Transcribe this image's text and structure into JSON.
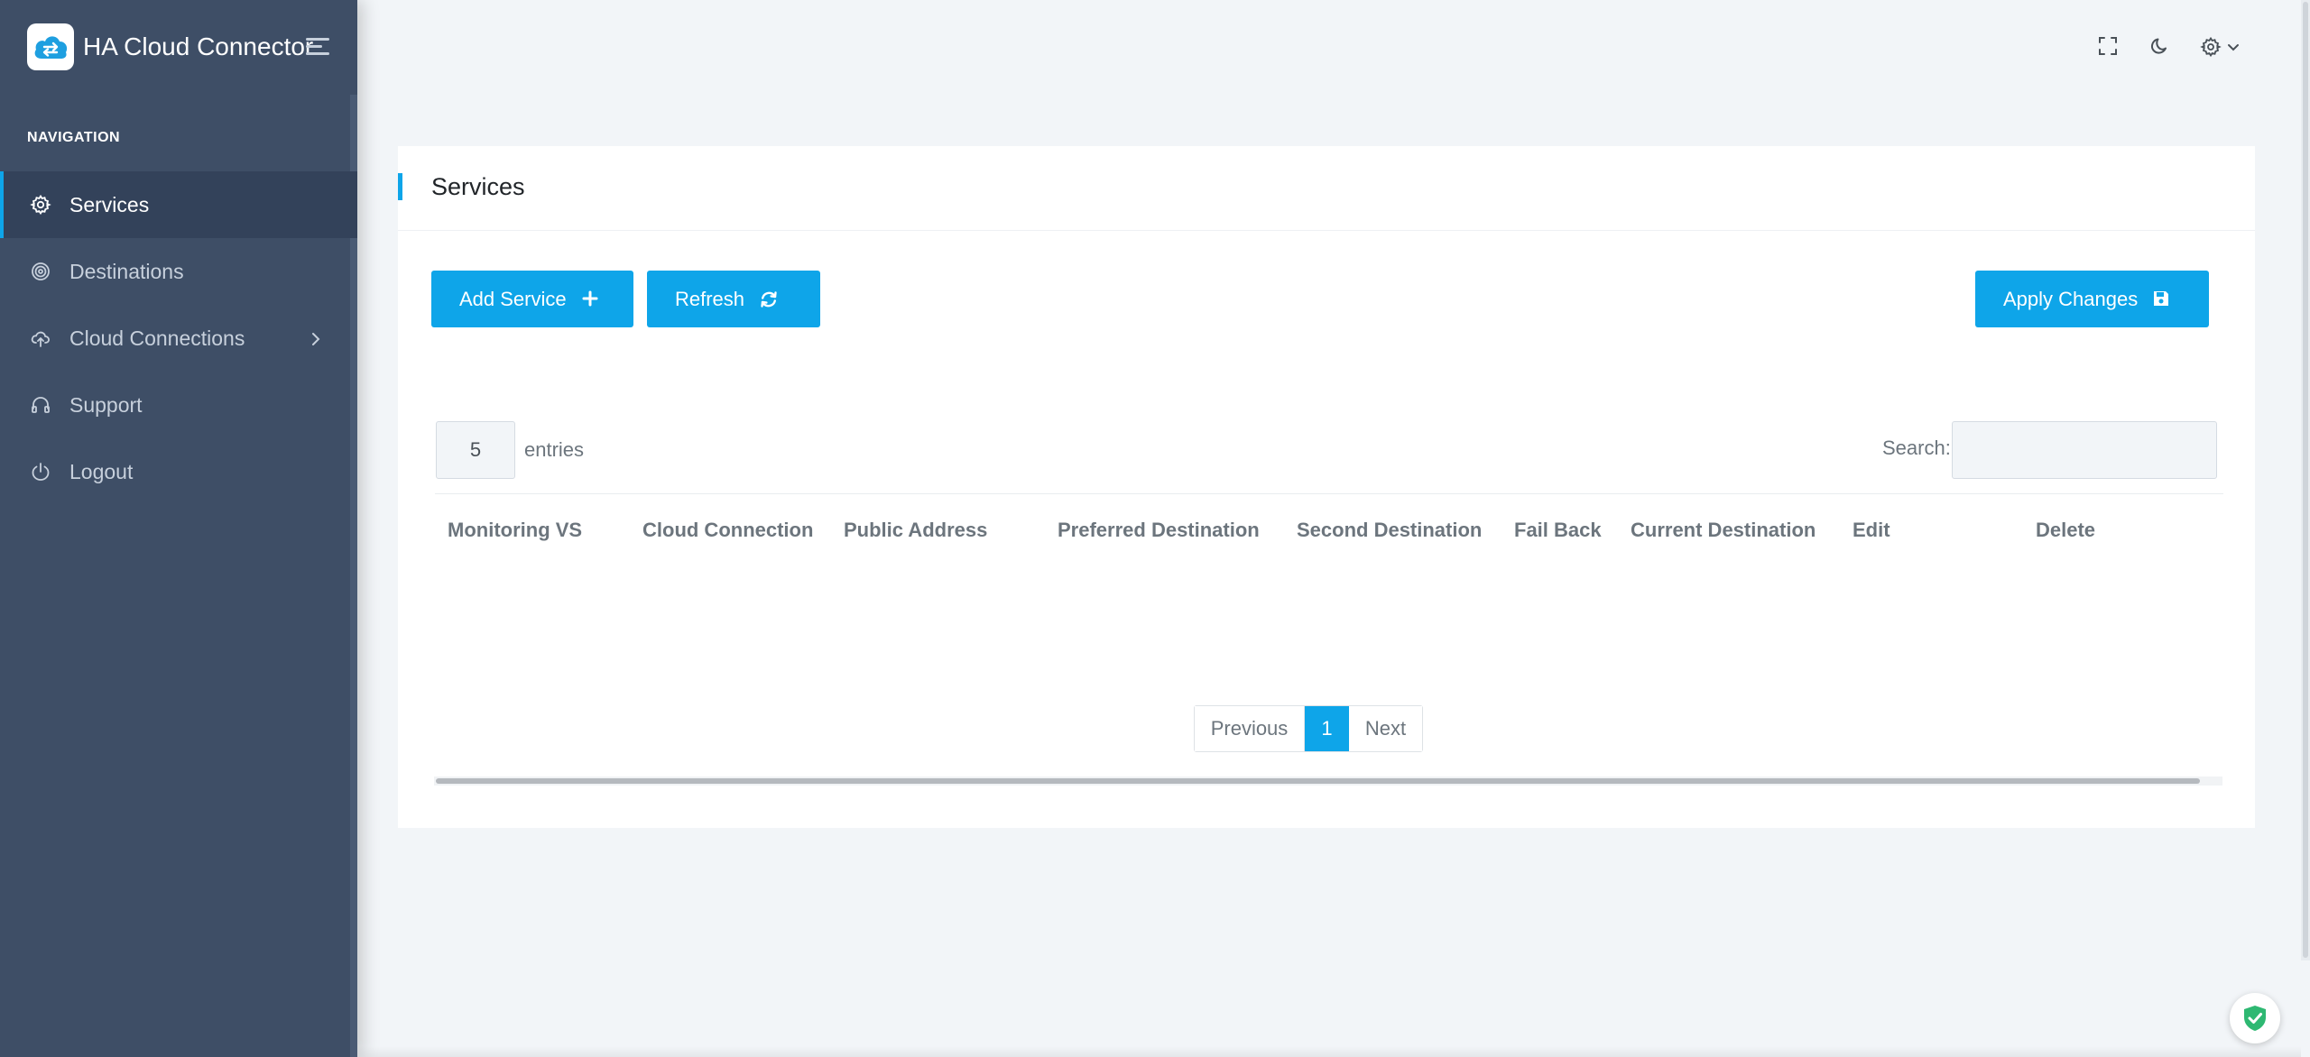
{
  "brand": {
    "title": "HA Cloud Connector"
  },
  "nav": {
    "heading": "NAVIGATION",
    "items": [
      {
        "label": "Services",
        "icon": "gear-icon",
        "active": true
      },
      {
        "label": "Destinations",
        "icon": "target-icon"
      },
      {
        "label": "Cloud Connections",
        "icon": "cloud-upload-icon",
        "has_submenu": true
      },
      {
        "label": "Support",
        "icon": "headphones-icon"
      },
      {
        "label": "Logout",
        "icon": "power-icon"
      }
    ]
  },
  "topbar": {
    "icons": [
      "fullscreen-icon",
      "moon-icon",
      "settings-icon",
      "chevron-down-icon"
    ]
  },
  "card": {
    "title": "Services",
    "buttons": {
      "add_service": "Add Service",
      "refresh": "Refresh",
      "apply_changes": "Apply Changes"
    },
    "entries": {
      "value": "5",
      "label": "entries"
    },
    "search": {
      "label": "Search:",
      "value": ""
    },
    "columns": [
      "Monitoring VS",
      "Cloud Connection",
      "Public Address",
      "Preferred Destination",
      "Second Destination",
      "Fail Back",
      "Current Destination",
      "Edit",
      "Delete"
    ],
    "rows": [],
    "pagination": {
      "previous": "Previous",
      "current": "1",
      "next": "Next"
    }
  },
  "colors": {
    "accent": "#0ea5e9",
    "sidebar": "#3e4e66",
    "sidebar_active": "#33425a",
    "background": "#f2f5f8"
  }
}
